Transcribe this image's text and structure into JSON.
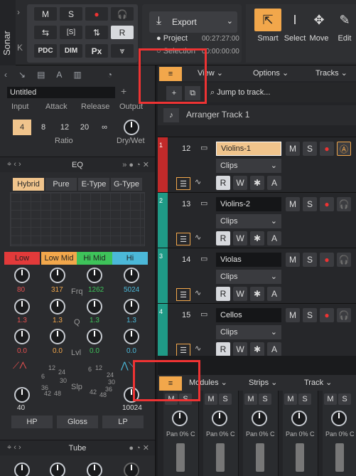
{
  "app": {
    "name": "Sonar"
  },
  "control_bar": {
    "buttons_row1": [
      "M",
      "S",
      "●",
      "🎧"
    ],
    "buttons_row2": [
      "⇆",
      "[S]",
      "⇅",
      "R"
    ],
    "buttons_row3": [
      "PDC",
      "DIM",
      "Px",
      "⩔"
    ],
    "export_label": "Export",
    "project_label": "Project",
    "project_time": "00:27:27:00",
    "selection_label": "Selection",
    "selection_time": "00:00:00:00"
  },
  "tools": [
    "Smart",
    "Select",
    "Move",
    "Edit"
  ],
  "left_panel": {
    "preset_name": "Untitled",
    "comp_labels": [
      "Input",
      "Attack",
      "Release",
      "Output"
    ],
    "ratio_values": [
      "4",
      "8",
      "12",
      "20",
      "∞"
    ],
    "ratio_label": "Ratio",
    "drywet_label": "Dry/Wet",
    "eq_title": "EQ",
    "eq_types": [
      "Hybrid",
      "Pure",
      "E-Type",
      "G-Type"
    ],
    "bands": [
      {
        "name": "Low",
        "color": "#e23a3a",
        "freq": "80",
        "q": "1.3",
        "lvl": "0.0"
      },
      {
        "name": "Low Mid",
        "color": "#f2a74b",
        "freq": "317",
        "q": "1.3",
        "lvl": "0.0"
      },
      {
        "name": "Hi Mid",
        "color": "#3ec35a",
        "freq": "1262",
        "q": "1.3",
        "lvl": "0.0"
      },
      {
        "name": "Hi",
        "color": "#4bb8d8",
        "freq": "5024",
        "q": "1.3",
        "lvl": "0.0"
      }
    ],
    "row_labels": [
      "Frq",
      "Q",
      "Lvl"
    ],
    "slope_label": "Slp",
    "slope_ticks_a": [
      "12",
      "24",
      "6",
      "30",
      "36",
      "42",
      "48"
    ],
    "slope_ticks_b": [
      "6",
      "12",
      "24",
      "30",
      "36",
      "42",
      "48"
    ],
    "hp_value": "40",
    "lp_value": "10024",
    "filter_buttons": [
      "HP",
      "Gloss",
      "LP"
    ],
    "tube_title": "Tube"
  },
  "track_view": {
    "menu": [
      "View",
      "Options",
      "Tracks"
    ],
    "jump_label": "Jump to track...",
    "arranger_label": "Arranger Track 1",
    "tracks": [
      {
        "index": "1",
        "number": "12",
        "name": "Violins-1",
        "selected": true,
        "stripe": "#c12a2a"
      },
      {
        "index": "2",
        "number": "13",
        "name": "Violins-2",
        "selected": false,
        "stripe": "#1f9a86"
      },
      {
        "index": "3",
        "number": "14",
        "name": "Violas",
        "selected": false,
        "stripe": "#1f9a86"
      },
      {
        "index": "4",
        "number": "15",
        "name": "Cellos",
        "selected": false,
        "stripe": "#1f9a86"
      }
    ],
    "clips_label": "Clips",
    "track_buttons": [
      "M",
      "S",
      "R",
      "W",
      "✱",
      "A"
    ]
  },
  "console": {
    "menu": [
      "Modules",
      "Strips",
      "Track"
    ],
    "strip_pan": [
      "0% C",
      "0% C",
      "0% C",
      "0% C",
      "0% C"
    ],
    "pan_label": "Pan"
  }
}
